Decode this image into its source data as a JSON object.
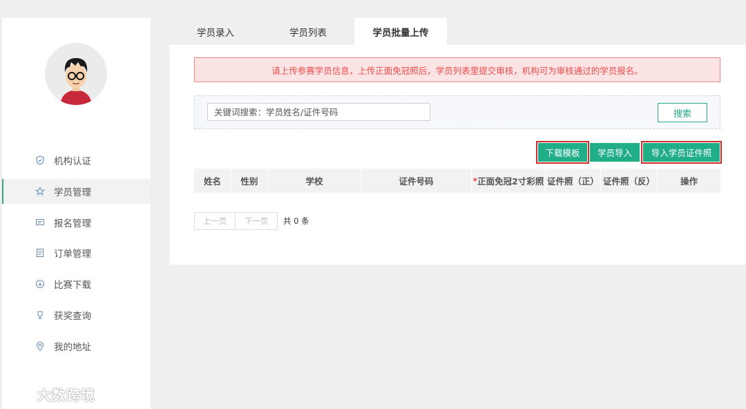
{
  "sidebar": {
    "items": [
      {
        "label": "机构认证",
        "icon": "shield-check-icon"
      },
      {
        "label": "学员管理",
        "icon": "star-icon",
        "active": true
      },
      {
        "label": "报名管理",
        "icon": "message-icon"
      },
      {
        "label": "订单管理",
        "icon": "document-icon"
      },
      {
        "label": "比赛下载",
        "icon": "download-icon"
      },
      {
        "label": "获奖查询",
        "icon": "trophy-icon"
      },
      {
        "label": "我的地址",
        "icon": "location-icon"
      }
    ]
  },
  "tabs": [
    {
      "label": "学员录入"
    },
    {
      "label": "学员列表"
    },
    {
      "label": "学员批量上传",
      "active": true
    }
  ],
  "notice": "请上传参赛学员信息，上传正面免冠照后，学员列表里提交审核，机构可为审核通过的学员报名。",
  "search": {
    "placeholder": "关键词搜索：学员姓名/证件号码",
    "button": "搜索"
  },
  "actions": {
    "download_template": "下载模板",
    "import_students": "学员导入",
    "import_id_photos": "导入学员证件照"
  },
  "table": {
    "columns": [
      "姓名",
      "性别",
      "学校",
      "证件号码",
      "正面免冠2寸彩照",
      "证件照（正）",
      "证件照（反）",
      "操作"
    ],
    "required_mark": "*"
  },
  "pager": {
    "prev": "上一页",
    "next": "下一页",
    "total": "共 0 条"
  },
  "watermark": "大数跨境",
  "colors": {
    "accent": "#1fae85",
    "notice_bg": "#fde4e4",
    "notice_text": "#e84c4c",
    "highlight_outline": "#d12a2a"
  }
}
